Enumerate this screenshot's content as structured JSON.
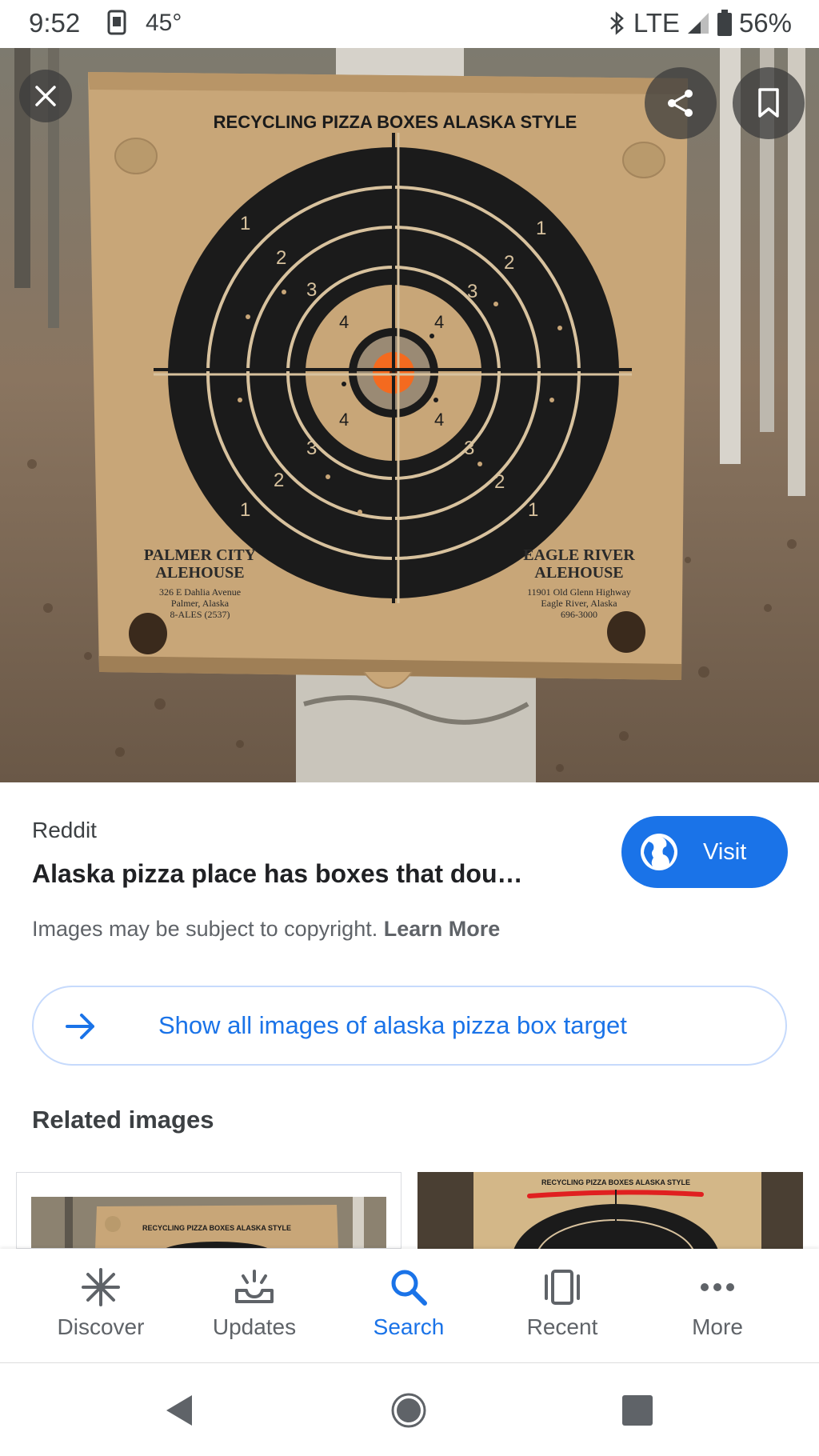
{
  "status_bar": {
    "time": "9:52",
    "temperature": "45°",
    "network": "LTE",
    "battery": "56%"
  },
  "image": {
    "box_heading": "RECYCLING PIZZA BOXES ALASKA STYLE",
    "left_name_1": "PALMER CITY",
    "left_name_2": "ALEHOUSE",
    "left_addr_1": "326 E Dahlia Avenue",
    "left_addr_2": "Palmer, Alaska",
    "left_addr_3": "8-ALES (2537)",
    "right_name_1": "EAGLE RIVER",
    "right_name_2": "ALEHOUSE",
    "right_addr_1": "11901 Old Glenn Highway",
    "right_addr_2": "Eagle River, Alaska",
    "right_addr_3": "696-3000",
    "ring_labels": [
      "1",
      "2",
      "3",
      "4"
    ]
  },
  "result": {
    "source": "Reddit",
    "title": "Alaska pizza place has boxes that dou…",
    "visit_label": "Visit",
    "copyright_text": "Images may be subject to copyright.",
    "learn_more": "Learn More"
  },
  "show_all": {
    "label": "Show all images of alaska pizza box target"
  },
  "related": {
    "heading": "Related images",
    "thumb1_text": "RECYCLING PIZZA BOXES ALASKA STYLE",
    "thumb2_text": "RECYCLING PIZZA BOXES ALASKA STYLE"
  },
  "bottom_nav": {
    "items": [
      {
        "label": "Discover",
        "icon": "asterisk-icon"
      },
      {
        "label": "Updates",
        "icon": "inbox-tray-icon"
      },
      {
        "label": "Search",
        "icon": "search-icon",
        "active": true
      },
      {
        "label": "Recent",
        "icon": "recent-cards-icon"
      },
      {
        "label": "More",
        "icon": "more-dots-icon"
      }
    ]
  },
  "colors": {
    "accent": "#1a73e8",
    "cardboard": "#c8a678",
    "target_black": "#1b1b1b",
    "bullseye": "#f46a1f"
  }
}
